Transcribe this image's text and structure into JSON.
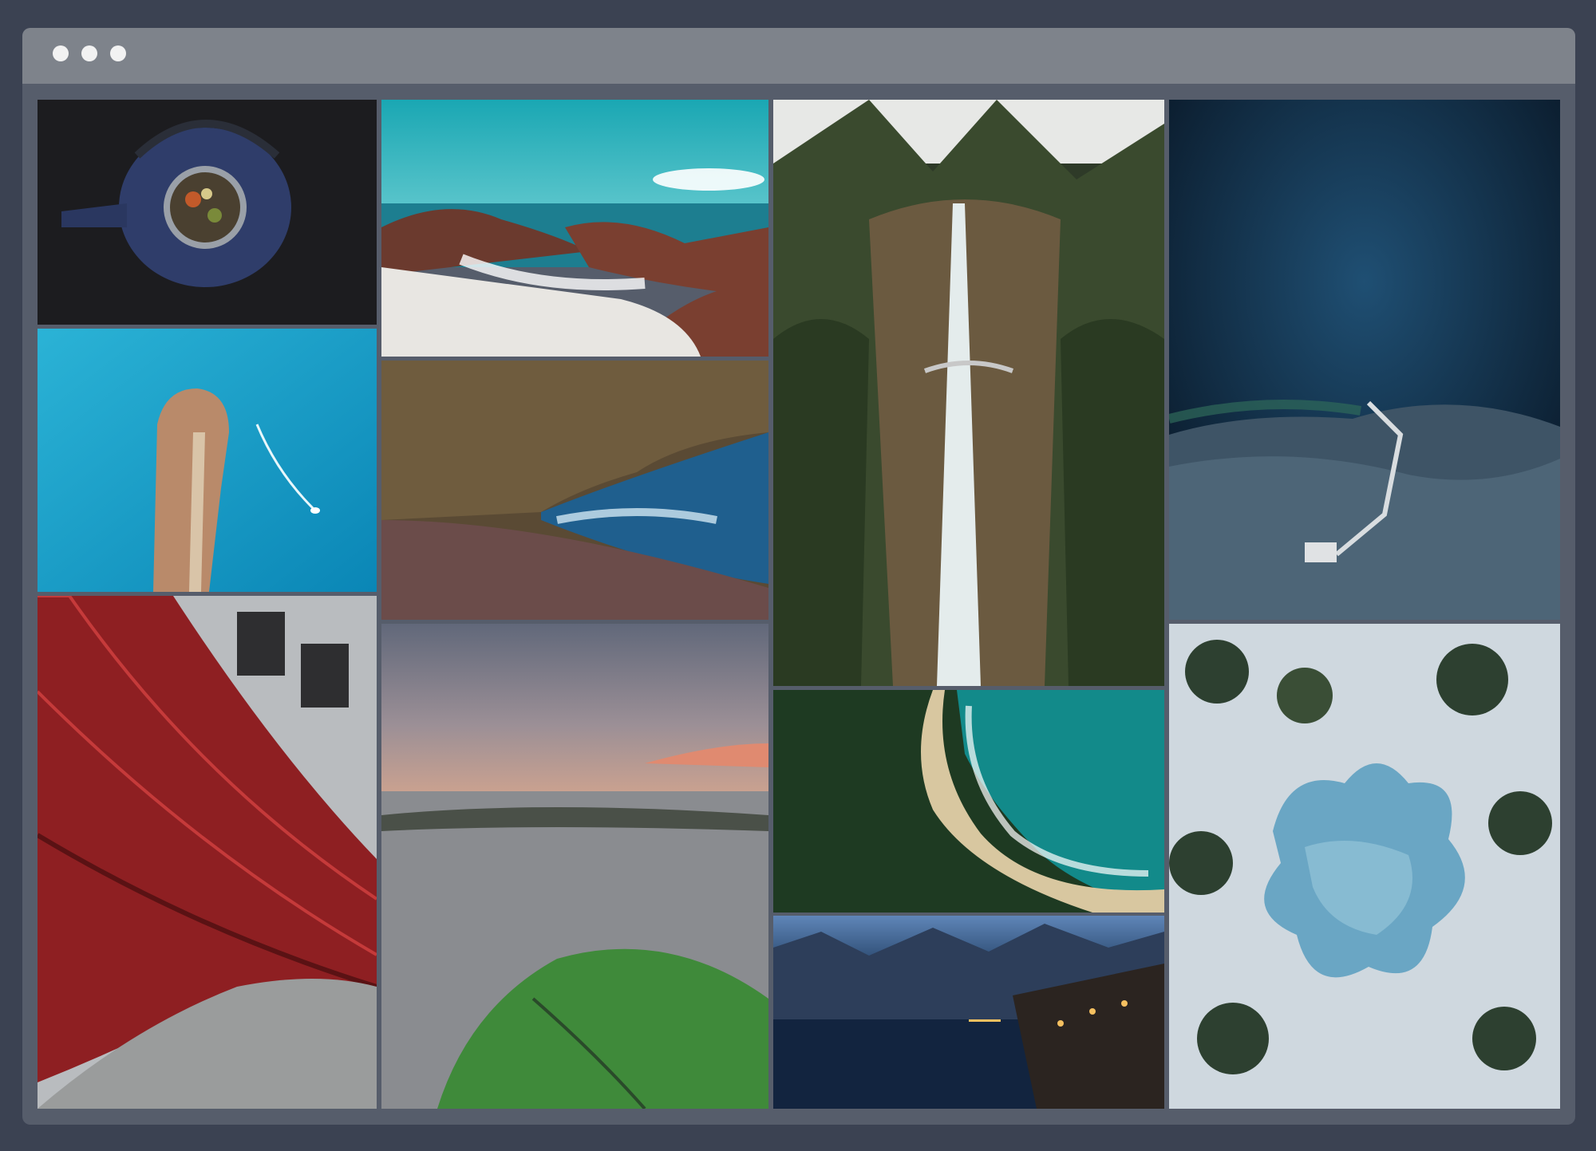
{
  "window": {
    "controls": [
      "dot",
      "dot",
      "dot"
    ],
    "colors": {
      "frame": "#565d6b",
      "titlebar": "#7e838b",
      "background": "#3b4252"
    }
  },
  "gallery": {
    "photos": [
      {
        "subject": "teapot"
      },
      {
        "subject": "rocky-beach"
      },
      {
        "subject": "waterfall"
      },
      {
        "subject": "deep-ocean-rock"
      },
      {
        "subject": "pier-aerial"
      },
      {
        "subject": "sea-cliffs"
      },
      {
        "subject": "red-building"
      },
      {
        "subject": "coast-sunset"
      },
      {
        "subject": "beach-aerial"
      },
      {
        "subject": "frozen-pond"
      },
      {
        "subject": "lake-village"
      }
    ]
  }
}
